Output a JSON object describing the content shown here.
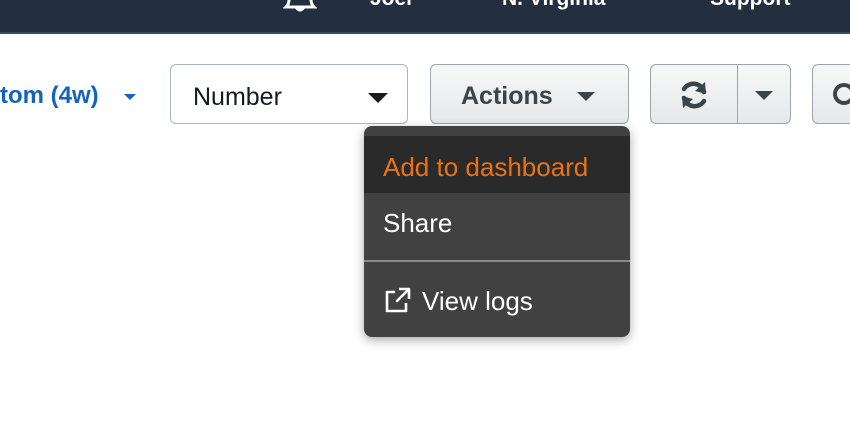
{
  "topnav": {
    "user_label": "Joel",
    "region_label": "N. Virginia",
    "support_label": "Support",
    "bell_icon": "bell-icon"
  },
  "toolbar": {
    "period_label": "tom (4w)",
    "view_select": {
      "value": "Number"
    },
    "actions_label": "Actions",
    "refresh_icon": "refresh-icon"
  },
  "actions_menu": {
    "items": [
      {
        "label": "Add to dashboard",
        "active": true
      },
      {
        "label": "Share"
      },
      {
        "label": "View logs",
        "icon": "external-link-icon"
      }
    ]
  },
  "colors": {
    "nav_background": "#232f3e",
    "link_blue": "#1166bb",
    "menu_background": "#414141",
    "menu_active_text": "#ec7211"
  }
}
